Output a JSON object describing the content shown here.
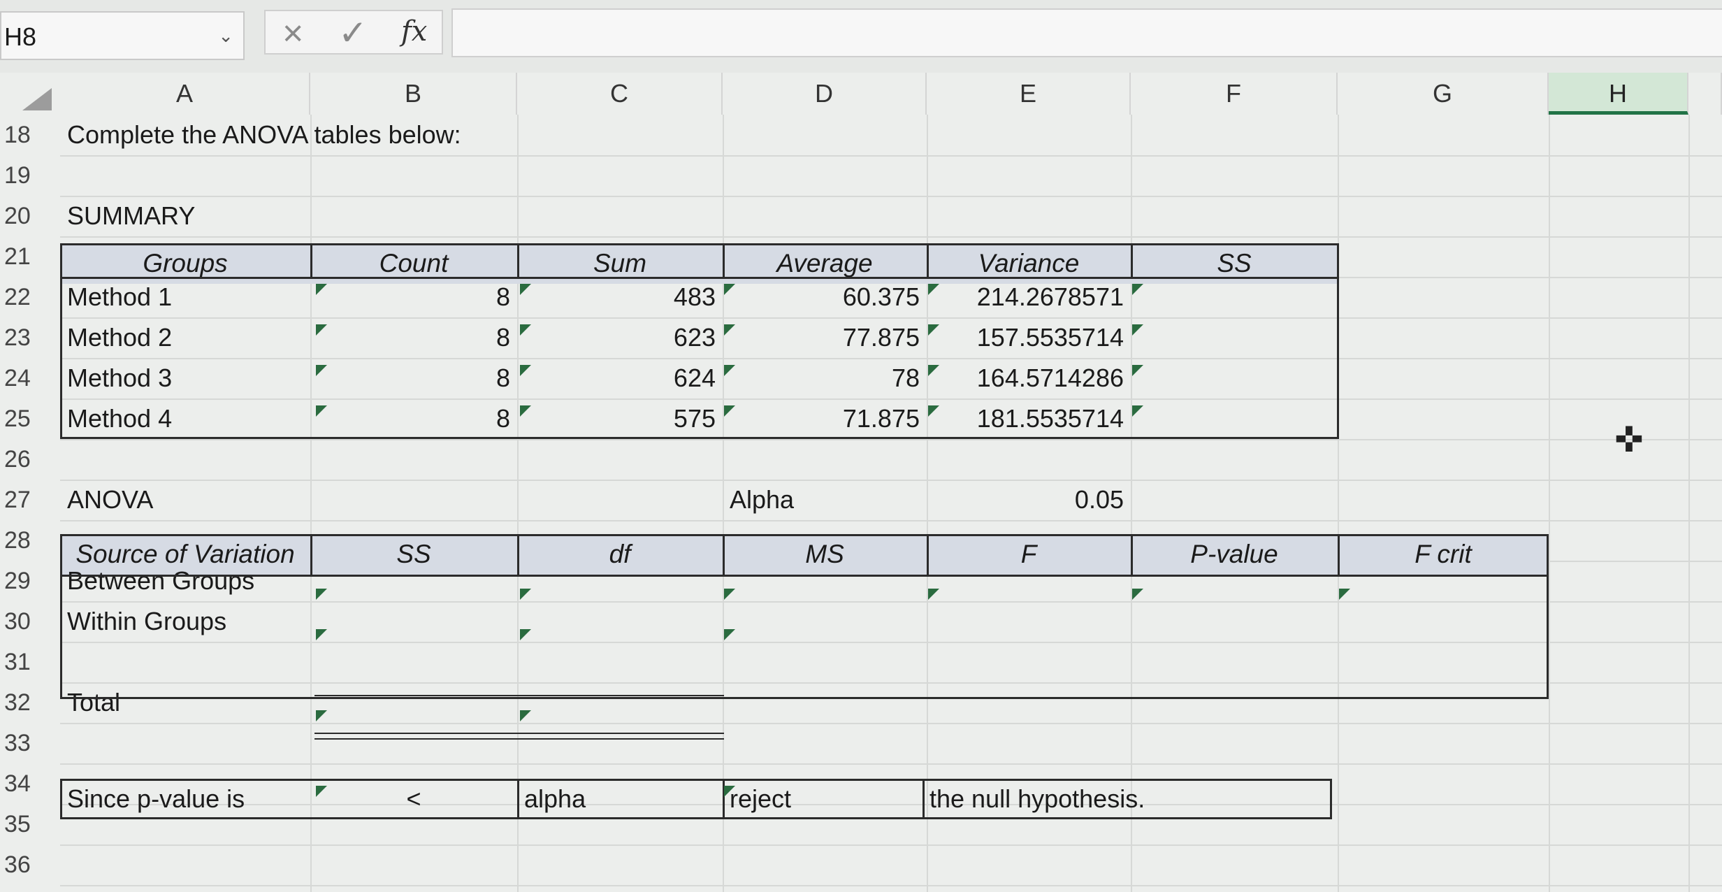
{
  "formula_bar": {
    "name_box": "H8",
    "name_box_chevron": "chevron-down-icon",
    "cancel": "×",
    "enter": "✓",
    "fx": "fx",
    "formula": ""
  },
  "columns": [
    "A",
    "B",
    "C",
    "D",
    "E",
    "F",
    "G",
    "H"
  ],
  "selected_column": "H",
  "rows": [
    "18",
    "19",
    "20",
    "21",
    "22",
    "23",
    "24",
    "25",
    "26",
    "27",
    "28",
    "29",
    "30",
    "31",
    "32",
    "33",
    "34",
    "35",
    "36"
  ],
  "instruction": "Complete the ANOVA tables below:",
  "summary": {
    "label": "SUMMARY",
    "headers": [
      "Groups",
      "Count",
      "Sum",
      "Average",
      "Variance",
      "SS"
    ],
    "rows": [
      {
        "group": "Method 1",
        "count": "8",
        "sum": "483",
        "average": "60.375",
        "variance": "214.2678571",
        "ss": ""
      },
      {
        "group": "Method 2",
        "count": "8",
        "sum": "623",
        "average": "77.875",
        "variance": "157.5535714",
        "ss": ""
      },
      {
        "group": "Method 3",
        "count": "8",
        "sum": "624",
        "average": "78",
        "variance": "164.5714286",
        "ss": ""
      },
      {
        "group": "Method 4",
        "count": "8",
        "sum": "575",
        "average": "71.875",
        "variance": "181.5535714",
        "ss": ""
      }
    ]
  },
  "anova": {
    "label": "ANOVA",
    "alpha_label": "Alpha",
    "alpha_value": "0.05",
    "headers": [
      "Source of Variation",
      "SS",
      "df",
      "MS",
      "F",
      "P-value",
      "F crit"
    ],
    "rows": [
      {
        "source": "Between Groups"
      },
      {
        "source": "Within Groups"
      },
      {
        "source": ""
      },
      {
        "source": "Total"
      }
    ]
  },
  "conclusion": {
    "since": "Since p-value is",
    "comparison": "<",
    "alpha": "alpha",
    "decision": "reject",
    "tail": "the null hypothesis."
  },
  "colors": {
    "selected_header": "#d3e7d6",
    "selected_accent": "#217346",
    "table_header": "#d6dbe4",
    "error_triangle": "#2a6b3f"
  }
}
